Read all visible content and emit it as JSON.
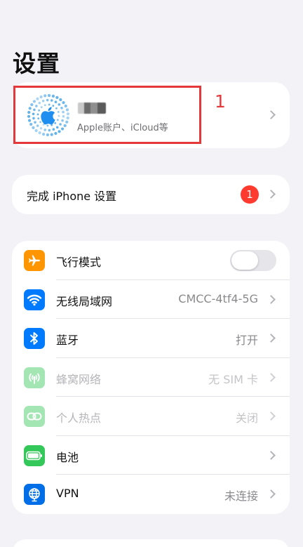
{
  "header": {
    "title": "设置"
  },
  "account": {
    "subtitle": "Apple账户、iCloud等",
    "annotation_number": "1",
    "highlight_color": "#e5383b"
  },
  "setup": {
    "label": "完成 iPhone 设置",
    "badge_count": "1"
  },
  "settings": [
    {
      "label": "飞行模式",
      "value": "",
      "icon": "airplane-icon",
      "color": "#ff9500",
      "toggle": "off"
    },
    {
      "label": "无线局域网",
      "value": "CMCC-4tf4-5G",
      "icon": "wifi-icon",
      "color": "#007aff"
    },
    {
      "label": "蓝牙",
      "value": "打开",
      "icon": "bluetooth-icon",
      "color": "#007aff"
    },
    {
      "label": "蜂窝网络",
      "value": "无 SIM 卡",
      "icon": "cellular-antenna-icon",
      "color": "#34c759",
      "disabled": true
    },
    {
      "label": "个人热点",
      "value": "关闭",
      "icon": "hotspot-link-icon",
      "color": "#34c759",
      "disabled": true
    },
    {
      "label": "电池",
      "value": "",
      "icon": "battery-icon",
      "color": "#34c759"
    },
    {
      "label": "VPN",
      "value": "未连接",
      "icon": "globe-icon",
      "color": "#006ee6"
    }
  ]
}
